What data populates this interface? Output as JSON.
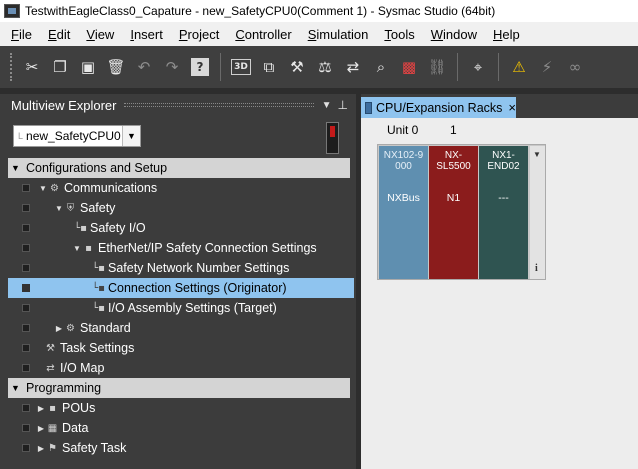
{
  "window": {
    "title": "TestwithEagleClass0_Capature - new_SafetyCPU0(Comment 1) - Sysmac Studio (64bit)"
  },
  "menu": [
    {
      "label": "File",
      "accel": "F",
      "rest": "ile"
    },
    {
      "label": "Edit",
      "accel": "E",
      "rest": "dit"
    },
    {
      "label": "View",
      "accel": "V",
      "rest": "iew"
    },
    {
      "label": "Insert",
      "accel": "I",
      "rest": "nsert"
    },
    {
      "label": "Project",
      "accel": "P",
      "rest": "roject"
    },
    {
      "label": "Controller",
      "accel": "C",
      "rest": "ontroller"
    },
    {
      "label": "Simulation",
      "accel": "S",
      "rest": "imulation"
    },
    {
      "label": "Tools",
      "accel": "T",
      "rest": "ools"
    },
    {
      "label": "Window",
      "accel": "W",
      "rest": "indow"
    },
    {
      "label": "Help",
      "accel": "H",
      "rest": "elp"
    }
  ],
  "toolbar": {
    "icons": [
      "cut-icon",
      "copy-icon",
      "paste-icon",
      "delete-icon",
      "undo-icon",
      "redo-icon",
      "help-icon",
      "3d-view-icon",
      "window-icon",
      "build-icon",
      "compare-icon",
      "transfer-icon",
      "search-icon",
      "error-icon",
      "offline-icon",
      "monitor-icon",
      "warning-icon",
      "online-icon",
      "glasses-icon"
    ],
    "box_label": "3D",
    "help_label": "?"
  },
  "explorer": {
    "title": "Multiview Explorer",
    "device": {
      "prefix": "L",
      "value": "new_SafetyCPU0"
    },
    "sections": {
      "config": "Configurations and Setup",
      "programming": "Programming"
    },
    "items": {
      "communications": "Communications",
      "safety": "Safety",
      "safety_io": "Safety I/O",
      "ethernet_ip": "EtherNet/IP Safety Connection Settings",
      "network_number": "Safety Network Number Settings",
      "connection_settings": "Connection Settings (Originator)",
      "io_assembly": "I/O Assembly Settings (Target)",
      "standard": "Standard",
      "task_settings": "Task Settings",
      "io_map": "I/O Map",
      "pous": "POUs",
      "data": "Data",
      "safety_task": "Safety Task"
    }
  },
  "tab": {
    "label": "CPU/Expansion Racks",
    "close": "×"
  },
  "rack": {
    "unit_label": "Unit 0",
    "unit_index": "1",
    "units": [
      {
        "name_line1": "NX102-9",
        "name_line2": "000",
        "bus": "NXBus",
        "color": "#5f8fb0"
      },
      {
        "name_line1": "NX-",
        "name_line2": "SL5500",
        "bus": "N1",
        "color": "#8b1c1c"
      },
      {
        "name_line1": "NX1-",
        "name_line2": "END02",
        "bus": "---",
        "color": "#2f5451"
      }
    ],
    "info": "i"
  }
}
